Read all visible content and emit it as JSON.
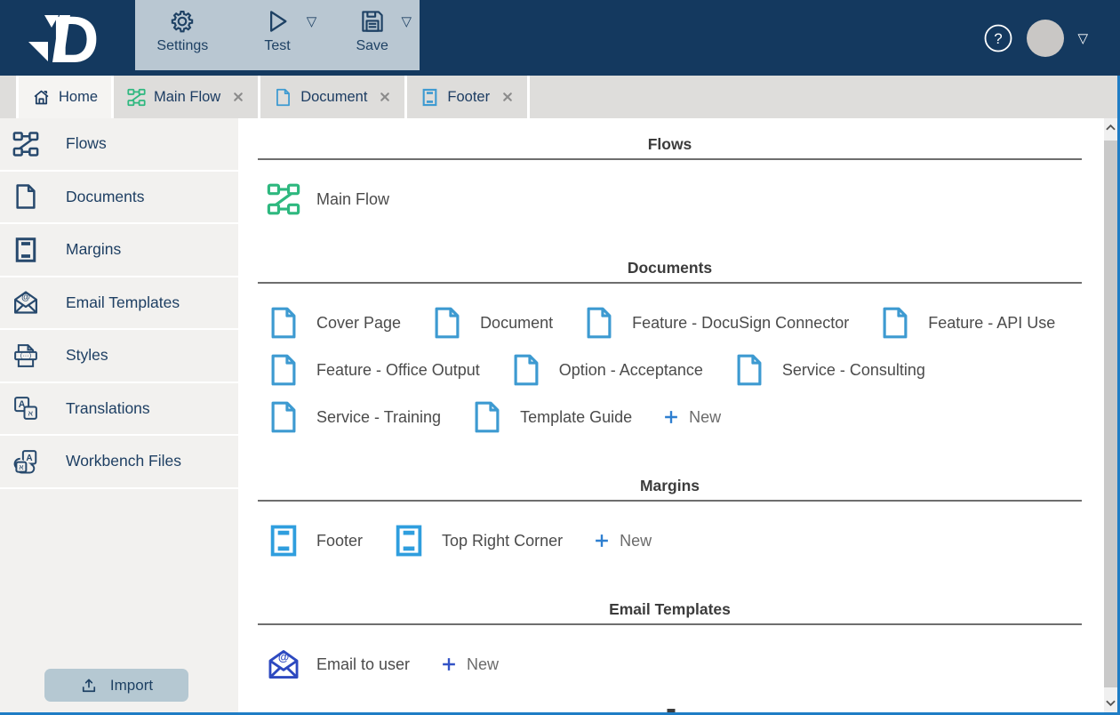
{
  "topbar": {
    "buttons": [
      {
        "label": "Settings",
        "icon": "gear-icon",
        "has_dropdown": false
      },
      {
        "label": "Test",
        "icon": "play-icon",
        "has_dropdown": true
      },
      {
        "label": "Save",
        "icon": "save-icon",
        "has_dropdown": true
      }
    ],
    "help_glyph": "?",
    "user_menu_caret": "▽",
    "dropdown_caret": "▽"
  },
  "tabs": [
    {
      "label": "Home",
      "icon": "home-icon",
      "active": true,
      "closable": false
    },
    {
      "label": "Main Flow",
      "icon": "flow-icon",
      "active": false,
      "closable": true
    },
    {
      "label": "Document",
      "icon": "document-icon",
      "active": false,
      "closable": true
    },
    {
      "label": "Footer",
      "icon": "margin-icon",
      "active": false,
      "closable": true
    }
  ],
  "sidebar": {
    "items": [
      {
        "label": "Flows",
        "icon": "flow-icon"
      },
      {
        "label": "Documents",
        "icon": "document-icon"
      },
      {
        "label": "Margins",
        "icon": "margin-icon"
      },
      {
        "label": "Email Templates",
        "icon": "email-icon"
      },
      {
        "label": "Styles",
        "icon": "styles-icon"
      },
      {
        "label": "Translations",
        "icon": "translations-icon"
      },
      {
        "label": "Workbench Files",
        "icon": "workbench-icon"
      }
    ],
    "import_label": "Import"
  },
  "content": {
    "new_label": "New",
    "sections": [
      {
        "title": "Flows",
        "icon": "flow-icon",
        "icon_color": "#2EB87F",
        "new_button": false,
        "rows": [
          [
            "Main Flow"
          ]
        ]
      },
      {
        "title": "Documents",
        "icon": "document-icon",
        "icon_color": "#3D9AD1",
        "new_button": true,
        "plus_color": "#2E7FD0",
        "rows": [
          [
            "Cover Page",
            "Document",
            "Feature - DocuSign Connector",
            "Feature - API Use"
          ],
          [
            "Feature - Office Output",
            "Option - Acceptance",
            "Service - Consulting"
          ],
          [
            "Service - Training",
            "Template Guide"
          ]
        ]
      },
      {
        "title": "Margins",
        "icon": "margin-icon",
        "icon_color": "#2F9EDE",
        "new_button": true,
        "plus_color": "#2E7FD0",
        "rows": [
          [
            "Footer",
            "Top Right Corner"
          ]
        ]
      },
      {
        "title": "Email Templates",
        "icon": "email-icon",
        "icon_color": "#2D49C0",
        "new_button": true,
        "plus_color": "#3353C6",
        "rows": [
          [
            "Email to user"
          ]
        ]
      }
    ]
  },
  "colors": {
    "navy": "#14395F",
    "toolbar_panel": "#B9C7D2",
    "toolbar_text": "#1E4164",
    "tabbar_bg": "#DEDDDB",
    "tab_active_bg": "#F5F4F2",
    "tab_text": "#1C3C62",
    "sidebar_bg": "#F2F1EF",
    "sidebar_text": "#1E3F63",
    "sidebar_icon": "#27496D",
    "heading_text": "#3C3C3C",
    "item_text": "#4B4B4B",
    "rule_gray": "#6E6E6E",
    "close_gray": "#8B8B8B",
    "new_text": "#6B6B6B",
    "border_blue": "#1F7DC5",
    "import_bg": "#B5C8D2",
    "avatar_gray": "#C9C7C5",
    "scroll_track": "#F0F0F0",
    "scroll_thumb": "#C9C9C9"
  }
}
